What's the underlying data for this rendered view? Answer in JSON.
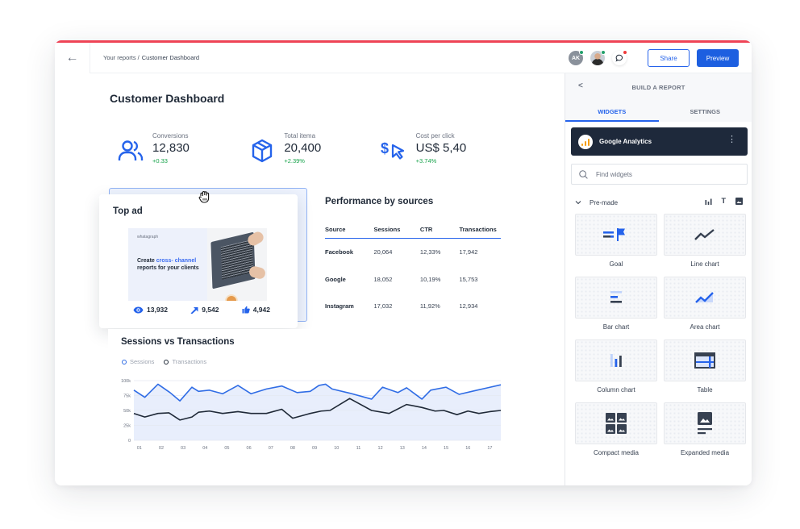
{
  "header": {
    "back_label": "←",
    "breadcrumb": [
      "Your reports /",
      "Customer Dashboard"
    ],
    "avatars": [
      {
        "initials": "AK",
        "status": "online"
      },
      {
        "initials": "",
        "status": "online"
      }
    ],
    "chat_notification": true,
    "share_label": "Share",
    "preview_label": "Preview"
  },
  "page": {
    "title": "Customer Dashboard"
  },
  "kpis": [
    {
      "icon": "users-icon",
      "label": "Conversions",
      "value": "12,830",
      "delta": "+0.33"
    },
    {
      "icon": "box-icon",
      "label": "Total itema",
      "value": "20,400",
      "delta": "+2.39%"
    },
    {
      "icon": "dollar-click-icon",
      "label": "Cost per click",
      "value": "US$ 5,40",
      "delta": "+3.74%"
    }
  ],
  "top_ad": {
    "title": "Top ad",
    "brand": "whatagraph",
    "headline_pre": "Create ",
    "headline_highlight_1": "cross-",
    "headline_highlight_2": "channel",
    "headline_post": " reports for your clients",
    "stats": [
      {
        "icon": "eye-icon",
        "value": "13,932"
      },
      {
        "icon": "arrow-icon",
        "value": "9,542"
      },
      {
        "icon": "thumbs-up-icon",
        "value": "4,942"
      }
    ]
  },
  "performance": {
    "title": "Performance by sources",
    "columns": [
      "Source",
      "Sessions",
      "CTR",
      "Transactions"
    ],
    "rows": [
      [
        "Facebook",
        "20,064",
        "12,33%",
        "17,942"
      ],
      [
        "Google",
        "18,052",
        "10,19%",
        "15,753"
      ],
      [
        "Instagram",
        "17,032",
        "11,92%",
        "12,934"
      ]
    ]
  },
  "chart_data": {
    "type": "line",
    "title": "Sessions vs Transactions",
    "xlabel": "",
    "ylabel": "",
    "ylim": [
      0,
      100000
    ],
    "yticks": [
      "0",
      "25k",
      "50k",
      "75k",
      "100k"
    ],
    "ytick_values": [
      0,
      25000,
      50000,
      75000,
      100000
    ],
    "xticks": [
      "01",
      "02",
      "03",
      "04",
      "05",
      "06",
      "07",
      "08",
      "09",
      "10",
      "11",
      "12",
      "13",
      "14",
      "15",
      "16",
      "17"
    ],
    "x_range": [
      0.75,
      17.5
    ],
    "grid": true,
    "legend": "top-left",
    "series": [
      {
        "name": "Sessions",
        "color": "#2f6ce5",
        "fill": "#e8eefc",
        "x": [
          0.75,
          1.25,
          1.85,
          2.4,
          2.85,
          3.4,
          3.7,
          4.2,
          4.8,
          5.5,
          6.1,
          6.8,
          7.5,
          8.2,
          8.8,
          9.2,
          9.5,
          9.8,
          10.6,
          11.6,
          12.1,
          12.8,
          13.2,
          13.9,
          14.3,
          15.0,
          15.6,
          16.3,
          16.9,
          17.5
        ],
        "values": [
          84000,
          72000,
          94000,
          80000,
          66000,
          89000,
          82000,
          84000,
          78000,
          92000,
          78000,
          86000,
          91000,
          80000,
          82000,
          92000,
          94000,
          86000,
          79000,
          69000,
          89000,
          80000,
          88000,
          69000,
          84000,
          89000,
          77000,
          83000,
          88000,
          93000
        ]
      },
      {
        "name": "Transactions",
        "color": "#1f2937",
        "x": [
          0.75,
          1.25,
          1.85,
          2.35,
          2.85,
          3.4,
          3.7,
          4.2,
          4.8,
          5.5,
          6.1,
          6.8,
          7.5,
          8.0,
          8.8,
          9.3,
          9.7,
          10.6,
          11.6,
          12.4,
          13.2,
          13.9,
          14.5,
          14.9,
          15.5,
          16.0,
          16.5,
          17.0,
          17.5
        ],
        "values": [
          45000,
          39000,
          45000,
          46000,
          34000,
          39000,
          47000,
          49000,
          45000,
          48000,
          45000,
          45000,
          52000,
          37000,
          45000,
          49000,
          50000,
          70000,
          50000,
          45000,
          60000,
          55000,
          49000,
          50000,
          43000,
          49000,
          45000,
          48000,
          50000
        ]
      }
    ]
  },
  "panel": {
    "back_label": "<",
    "title": "BUILD A REPORT",
    "tabs": [
      {
        "label": "WIDGETS",
        "active": true
      },
      {
        "label": "SETTINGS",
        "active": false
      }
    ],
    "source": {
      "name": "Google Analytics",
      "menu": "⋮"
    },
    "search": {
      "placeholder": "Find widgets",
      "value": ""
    },
    "section": {
      "label": "Pre-made",
      "filters": [
        "bar-filter-icon",
        "text-filter-icon",
        "image-filter-icon"
      ],
      "text_filter_label": "T"
    },
    "widgets": [
      {
        "id": "goal",
        "label": "Goal"
      },
      {
        "id": "line-chart",
        "label": "Line chart"
      },
      {
        "id": "bar-chart",
        "label": "Bar chart"
      },
      {
        "id": "area-chart",
        "label": "Area chart"
      },
      {
        "id": "column-chart",
        "label": "Column chart"
      },
      {
        "id": "table",
        "label": "Table"
      },
      {
        "id": "compact-media",
        "label": "Compact media"
      },
      {
        "id": "expanded-media",
        "label": "Expanded media"
      }
    ]
  }
}
